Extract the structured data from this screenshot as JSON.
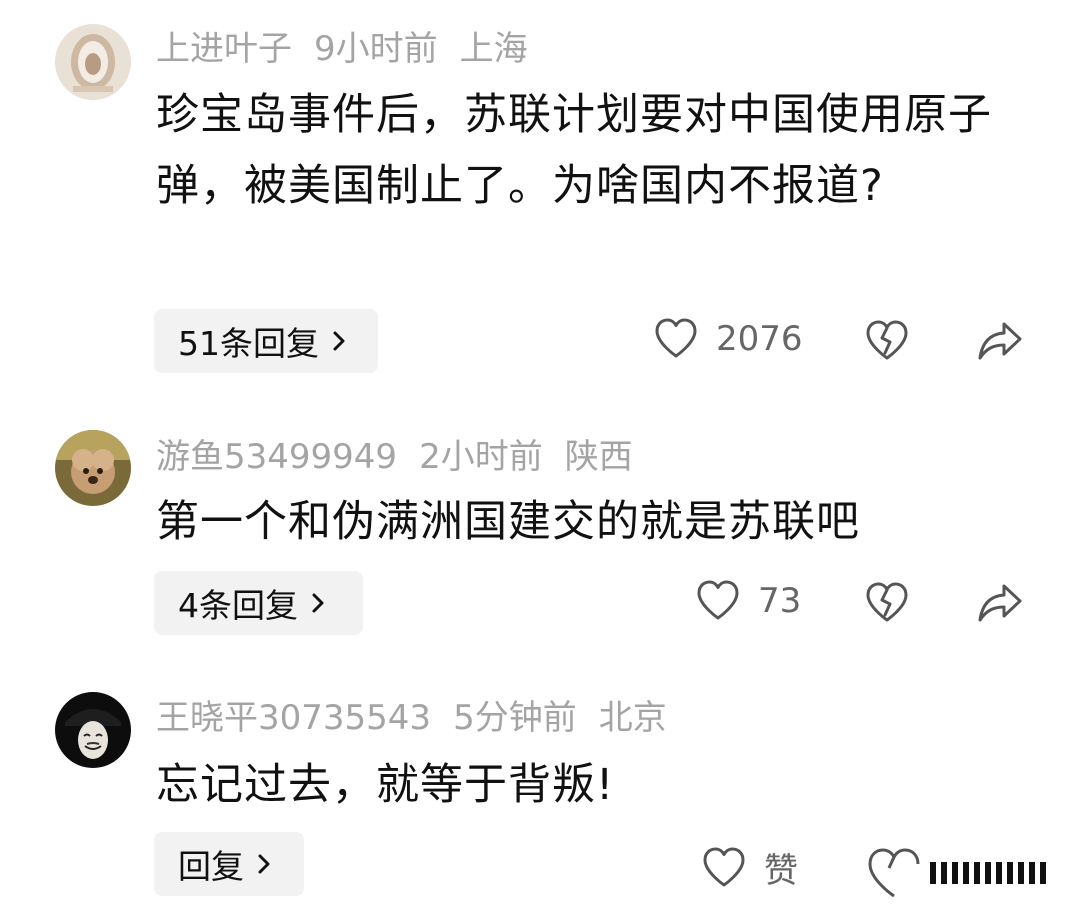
{
  "comments": [
    {
      "username": "上进叶子",
      "time": "9小时前",
      "location": "上海",
      "text": "珍宝岛事件后，苏联计划要对中国使用原子弹，被美国制止了。为啥国内不报道?",
      "reply_label": "51条回复",
      "like_count": "2076",
      "avatar_icon": "avatar-image"
    },
    {
      "username": "游鱼53499949",
      "time": "2小时前",
      "location": "陕西",
      "text": "第一个和伪满洲国建交的就是苏联吧",
      "reply_label": "4条回复",
      "like_count": "73",
      "avatar_icon": "avatar-image"
    },
    {
      "username": "王晓平30735543",
      "time": "5分钟前",
      "location": "北京",
      "text": "忘记过去，就等于背叛!",
      "reply_label": "回复",
      "like_count": "赞",
      "avatar_icon": "avatar-image"
    }
  ],
  "icons": {
    "like": "heart-icon",
    "dislike": "broken-heart-icon",
    "share": "share-arrow-icon",
    "reply_chevron": "chevron-right-icon"
  },
  "colors": {
    "text": "#111111",
    "meta": "#a4a4a4",
    "count": "#666666",
    "reply_bg": "#f2f2f2",
    "icon": "#555555"
  }
}
